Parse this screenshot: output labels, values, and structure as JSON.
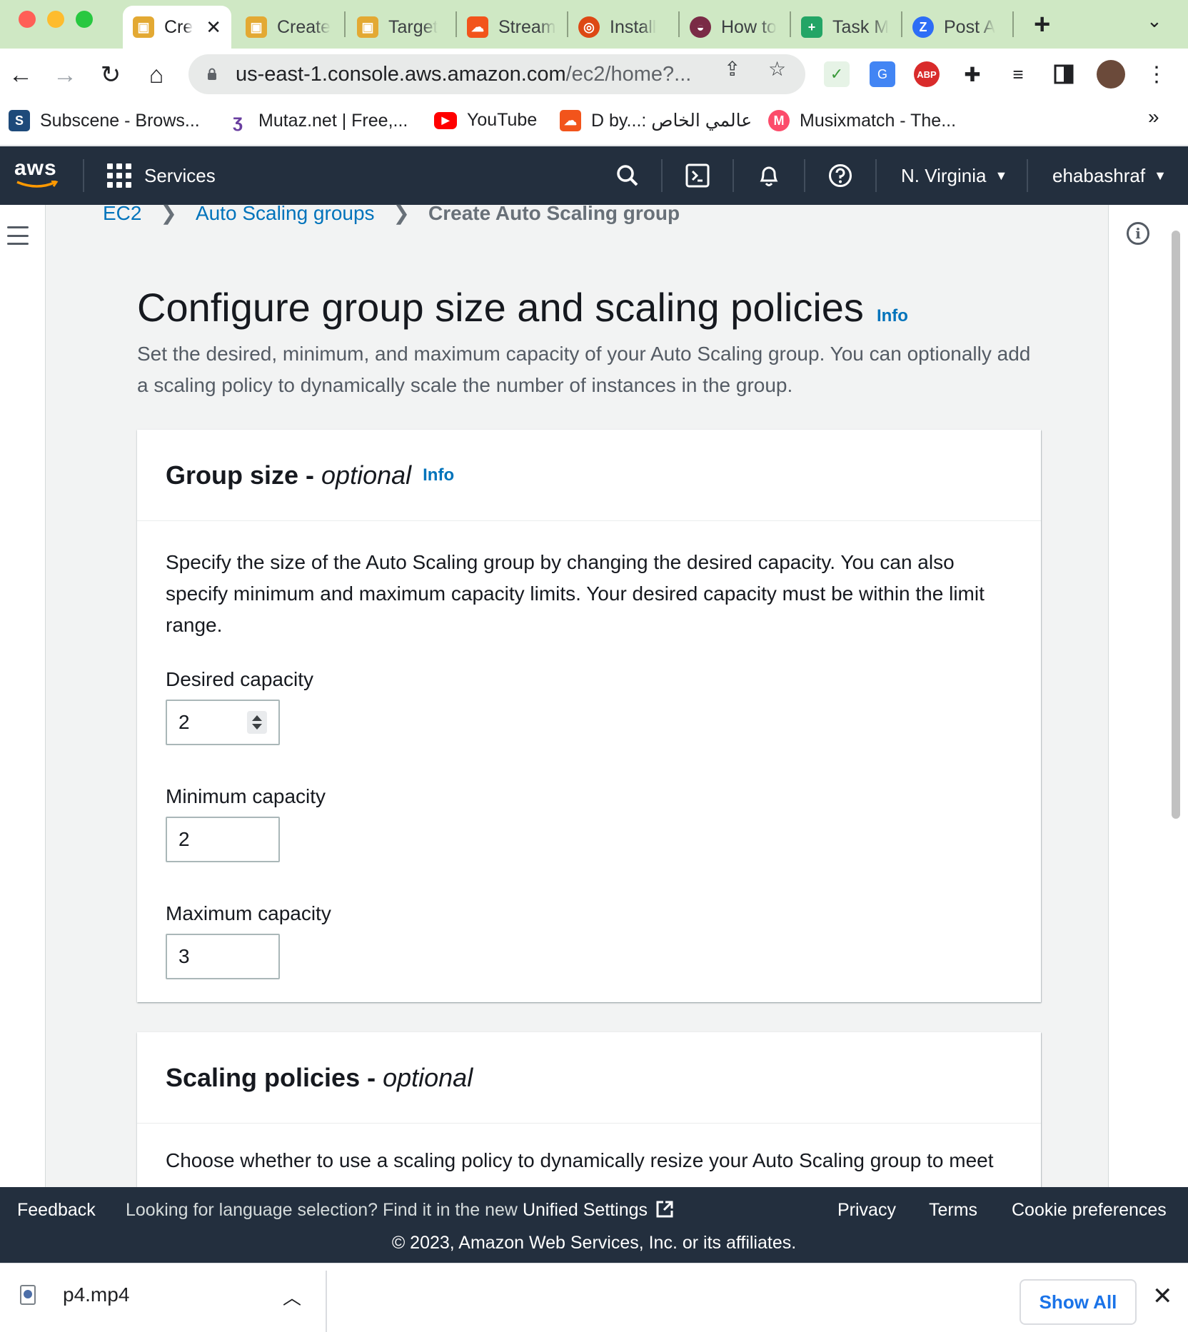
{
  "browser": {
    "tabs": [
      {
        "label": "Cre",
        "active": true,
        "favicon": "aws-box-icon",
        "color": "#e3a933"
      },
      {
        "label": "Create",
        "favicon": "aws-box-icon",
        "color": "#e3a933"
      },
      {
        "label": "Target",
        "favicon": "aws-box-icon",
        "color": "#e3a933"
      },
      {
        "label": "Stream",
        "favicon": "soundcloud-icon",
        "color": "#f2541b"
      },
      {
        "label": "Install",
        "favicon": "ubuntu-icon",
        "color": "#dd4814"
      },
      {
        "label": "How to",
        "favicon": "book-icon",
        "color": "#7a2b46"
      },
      {
        "label": "Task M",
        "favicon": "plus-doc-icon",
        "color": "#23a566"
      },
      {
        "label": "Post A",
        "favicon": "z-icon",
        "color": "#2d6df6"
      }
    ],
    "url_host": "us-east-1.console.aws.amazon.com",
    "url_path": "/ec2/home?...",
    "bookmarks": [
      {
        "label": "Subscene - Brows...",
        "icon": "S",
        "color": "#1e4a7a"
      },
      {
        "label": "Mutaz.net | Free,...",
        "icon": "ʒ",
        "color": "#6a3fa0"
      },
      {
        "label": "YouTube",
        "icon": "▶",
        "color": "#ff0000"
      },
      {
        "label": "D by...: عالمي الخاص",
        "icon": "☁",
        "color": "#f2541b"
      },
      {
        "label": "Musixmatch - The...",
        "icon": "M",
        "color": "#fc4c6b"
      }
    ],
    "bookmarks_more": "»"
  },
  "aws_header": {
    "logo": "aws",
    "services": "Services",
    "region": "N. Virginia",
    "user": "ehabashraf"
  },
  "breadcrumb": {
    "items": [
      "EC2",
      "Auto Scaling groups"
    ],
    "current": "Create Auto Scaling group"
  },
  "page": {
    "title": "Configure group size and scaling policies",
    "info": "Info",
    "description": "Set the desired, minimum, and maximum capacity of your Auto Scaling group. You can optionally add a scaling policy to dynamically scale the number of instances in the group."
  },
  "group_size": {
    "heading": "Group size - ",
    "heading_optional": "optional",
    "info": "Info",
    "description": "Specify the size of the Auto Scaling group by changing the desired capacity. You can also specify minimum and maximum capacity limits. Your desired capacity must be within the limit range.",
    "desired_label": "Desired capacity",
    "desired_value": "2",
    "min_label": "Minimum capacity",
    "min_value": "2",
    "max_label": "Maximum capacity",
    "max_value": "3"
  },
  "scaling_policies": {
    "heading": "Scaling policies - ",
    "heading_optional": "optional",
    "description": "Choose whether to use a scaling policy to dynamically resize your Auto Scaling group to meet"
  },
  "footer": {
    "feedback": "Feedback",
    "language_prompt": "Looking for language selection? Find it in the new",
    "unified_settings": "Unified Settings",
    "privacy": "Privacy",
    "terms": "Terms",
    "cookies": "Cookie preferences",
    "copyright": "© 2023, Amazon Web Services, Inc. or its affiliates."
  },
  "downloads": {
    "file": "p4.mp4",
    "show_all": "Show All"
  },
  "colors": {
    "aws_nav": "#232f3e",
    "link": "#0073bb",
    "tabbar": "#cfe8c4"
  }
}
